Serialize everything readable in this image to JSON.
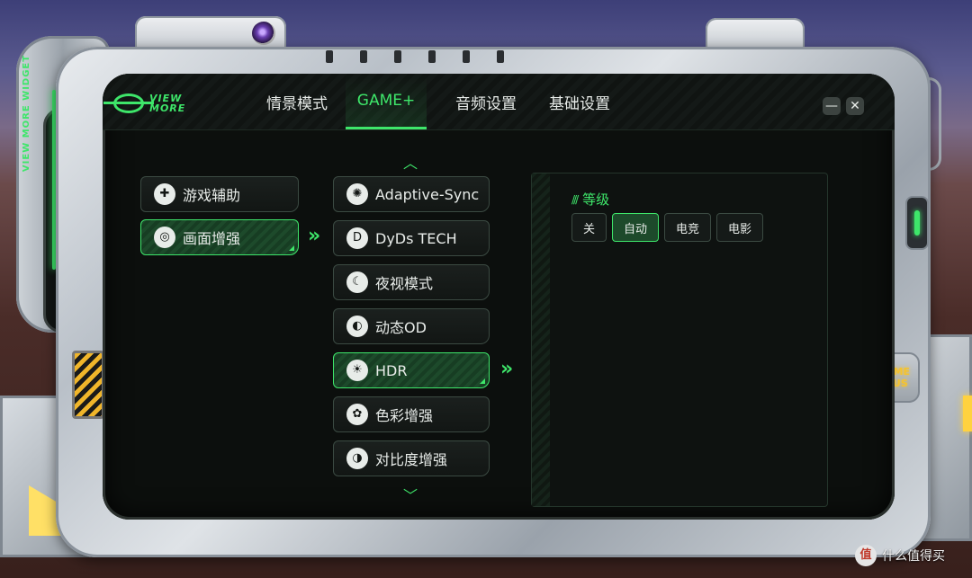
{
  "header": {
    "logo_text": "VIEW\nMORE",
    "tabs": [
      {
        "label": "情景模式",
        "active": false
      },
      {
        "label": "GAME+",
        "active": true
      },
      {
        "label": "音频设置",
        "active": false
      },
      {
        "label": "基础设置",
        "active": false
      }
    ],
    "minimize_label": "—",
    "close_label": "✕"
  },
  "side_label": "VIEW MORE WIDGET",
  "badge": "GAME\nPLUS",
  "primary_menu": [
    {
      "label": "游戏辅助",
      "icon": "gamepad-icon",
      "glyph": "✚",
      "active": false
    },
    {
      "label": "画面增强",
      "icon": "display-enhance-icon",
      "glyph": "◎",
      "active": true
    }
  ],
  "secondary_menu": [
    {
      "label": "Adaptive-Sync",
      "icon": "sync-icon",
      "glyph": "✺",
      "active": false
    },
    {
      "label": "DyDs TECH",
      "icon": "dyds-icon",
      "glyph": "D",
      "active": false
    },
    {
      "label": "夜视模式",
      "icon": "night-vision-icon",
      "glyph": "☾",
      "active": false
    },
    {
      "label": "动态OD",
      "icon": "dynamic-od-icon",
      "glyph": "◐",
      "active": false
    },
    {
      "label": "HDR",
      "icon": "hdr-icon",
      "glyph": "☀",
      "active": true
    },
    {
      "label": "色彩增强",
      "icon": "color-palette-icon",
      "glyph": "✿",
      "active": false
    },
    {
      "label": "对比度增强",
      "icon": "contrast-icon",
      "glyph": "◑",
      "active": false
    }
  ],
  "arrows": {
    "right": "»",
    "up": "︿",
    "down": "﹀"
  },
  "detail": {
    "title": "等级",
    "title_mark": "///",
    "options": [
      {
        "label": "关",
        "active": false
      },
      {
        "label": "自动",
        "active": true
      },
      {
        "label": "电竞",
        "active": false
      },
      {
        "label": "电影",
        "active": false
      }
    ]
  },
  "watermark": {
    "icon_glyph": "值",
    "text": "什么值得买"
  },
  "colors": {
    "accent": "#3ee66a",
    "screen_bg": "#0c0f0d",
    "badge": "#f4c330"
  }
}
